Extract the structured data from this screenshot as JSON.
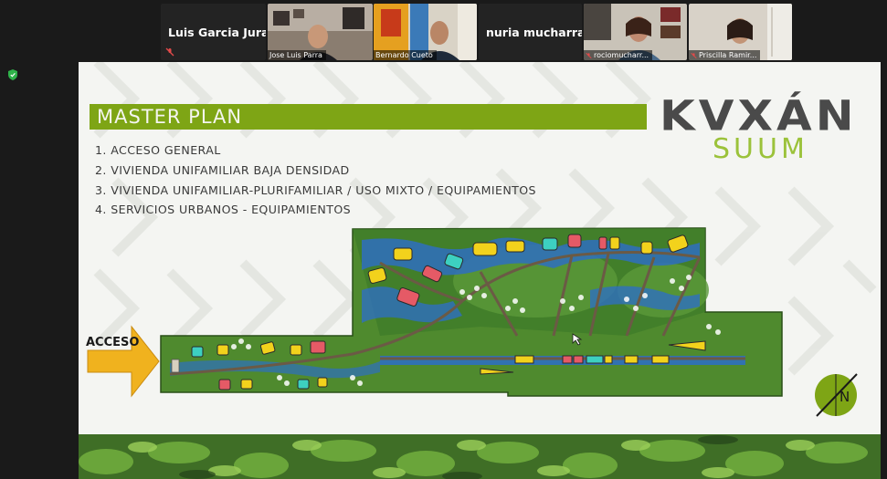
{
  "participants": [
    {
      "name": "Luis Garcia Jura..."
    },
    {
      "name": "Jose Luis Parra"
    },
    {
      "name": "Bernardo Cueto"
    },
    {
      "name": "nuria mucharraz"
    },
    {
      "name": "rociomucharr..."
    },
    {
      "name": "Priscilla Ramir..."
    }
  ],
  "slide": {
    "title": "MASTER PLAN",
    "list": [
      "1. ACCESO GENERAL",
      "2. VIVIENDA UNIFAMILIAR BAJA DENSIDAD",
      "3. VIVIENDA UNIFAMILIAR-PLURIFAMILIAR  / USO MIXTO / EQUIPAMIENTOS",
      "4. SERVICIOS URBANOS - EQUIPAMIENTOS"
    ],
    "logo_top": "KVXÁN",
    "logo_bottom": "SUUM",
    "access_label": "ACCESO",
    "compass_letter": "N"
  },
  "colors": {
    "title_bar": "#7ea515",
    "logo_dark": "#4a4a4a",
    "logo_green": "#9bc23a",
    "site_green": "#4f8a2e",
    "water": "#2e6fc0",
    "arrow": "#f0b21e"
  }
}
